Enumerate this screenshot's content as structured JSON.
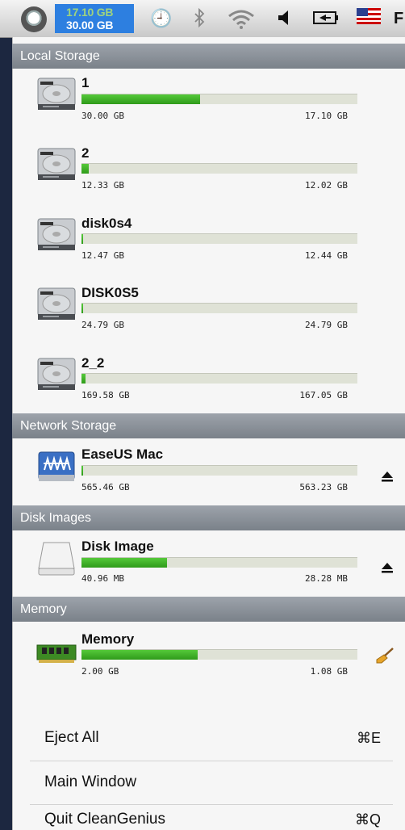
{
  "menubar": {
    "readout_used": "17.10 GB",
    "readout_total": "30.00 GB",
    "icons": [
      "app-icon",
      "time-machine-icon",
      "bluetooth-icon",
      "wifi-icon",
      "volume-icon",
      "battery-icon",
      "flag-icon"
    ],
    "cut_letter": "F"
  },
  "sections": {
    "local": "Local Storage",
    "network": "Network Storage",
    "images": "Disk Images",
    "memory": "Memory"
  },
  "disks": [
    {
      "name": "1",
      "capacity": "30.00 GB",
      "free": "17.10 GB",
      "usage": 0.43
    },
    {
      "name": "2",
      "capacity": "12.33 GB",
      "free": "12.02 GB",
      "usage": 0.025
    },
    {
      "name": "disk0s4",
      "capacity": "12.47 GB",
      "free": "12.44 GB",
      "usage": 0.003
    },
    {
      "name": "DISK0S5",
      "capacity": "24.79 GB",
      "free": "24.79 GB",
      "usage": 0.001
    },
    {
      "name": "2_2",
      "capacity": "169.58 GB",
      "free": "167.05 GB",
      "usage": 0.015
    }
  ],
  "network": {
    "name": "EaseUS Mac",
    "capacity": "565.46 GB",
    "free": "563.23 GB",
    "usage": 0.004
  },
  "image": {
    "name": "Disk Image",
    "capacity": "40.96 MB",
    "free": "28.28 MB",
    "usage": 0.31
  },
  "memory": {
    "name": "Memory",
    "capacity": "2.00 GB",
    "free": "1.08 GB",
    "usage": 0.42
  },
  "menu": {
    "eject_all": "Eject All",
    "eject_all_shortcut": "⌘E",
    "main_window": "Main Window",
    "quit": "Quit CleanGenius",
    "quit_shortcut": "⌘Q"
  },
  "colors": {
    "fill": "#3aa921",
    "readout_bg": "#2d7fe0",
    "section_bg": "#858c94"
  }
}
